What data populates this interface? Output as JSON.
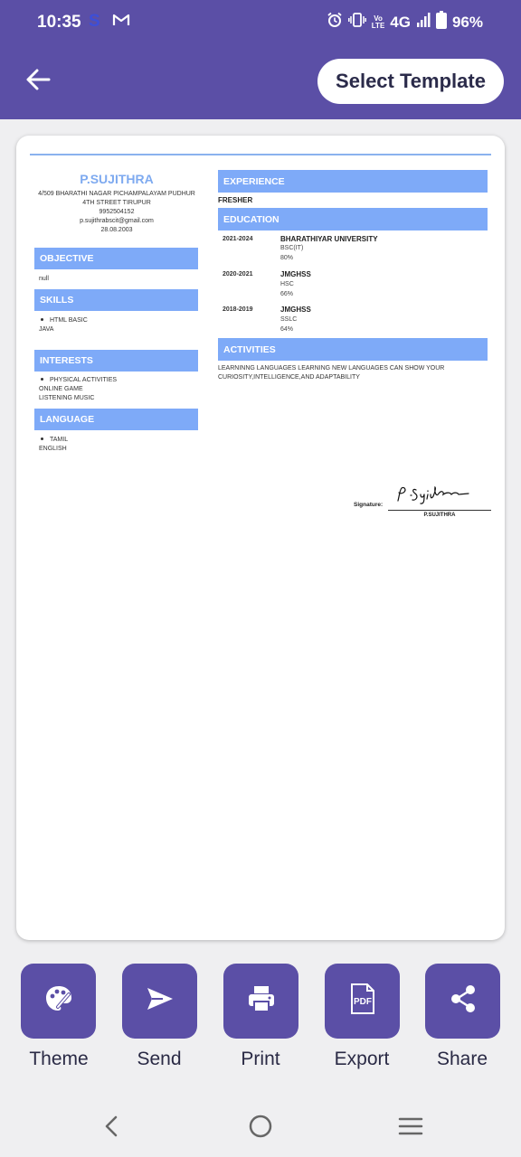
{
  "status_bar": {
    "time": "10:35",
    "s_icon": "S",
    "network": "4G",
    "volte": [
      "Vo",
      "LTE"
    ],
    "battery": "96%"
  },
  "app_bar": {
    "back_icon": "arrow-left-icon",
    "select_template_label": "Select Template"
  },
  "resume": {
    "name": "P.SUJITHRA",
    "address_lines": [
      "4/509 BHARATHI NAGAR PICHAMPALAYAM PUDHUR",
      "4TH STREET TIRUPUR",
      "9952504152",
      "p.sujithrabscit@gmail.com",
      "28.08.2003"
    ],
    "objective": {
      "title": "OBJECTIVE",
      "text": "null"
    },
    "skills": {
      "title": "SKILLS",
      "items": [
        "HTML BASIC",
        "JAVA"
      ]
    },
    "interests": {
      "title": "INTERESTS",
      "items": [
        "PHYSICAL ACTIVITIES",
        "ONLINE GAME",
        "LISTENING MUSIC"
      ]
    },
    "language": {
      "title": "LANGUAGE",
      "items": [
        "TAMIL",
        "ENGLISH"
      ]
    },
    "experience": {
      "title": "EXPERIENCE",
      "text": "FRESHER"
    },
    "education": {
      "title": "EDUCATION",
      "entries": [
        {
          "years": "2021-2024",
          "institution": "BHARATHIYAR UNIVERSITY",
          "course": "BSC(IT)",
          "score": "80%"
        },
        {
          "years": "2020-2021",
          "institution": "JMGHSS",
          "course": "HSC",
          "score": "66%"
        },
        {
          "years": "2018-2019",
          "institution": "JMGHSS",
          "course": "SSLC",
          "score": "64%"
        }
      ]
    },
    "activities": {
      "title": "ACTIVITIES",
      "text": "LEARNINNG LANGUAGES LEARNING NEW LANGUAGES CAN SHOW YOUR CURIOSITY,INTELLIGENCE,AND ADAPTABILITY"
    },
    "signature": {
      "label": "Signature:",
      "name": "P.SUJITHRA"
    }
  },
  "actions": [
    {
      "label": "Theme",
      "icon": "palette-icon"
    },
    {
      "label": "Send",
      "icon": "send-icon"
    },
    {
      "label": "Print",
      "icon": "printer-icon"
    },
    {
      "label": "Export",
      "icon": "pdf-icon"
    },
    {
      "label": "Share",
      "icon": "share-icon"
    }
  ],
  "nav_bar": {
    "icons": [
      "back-nav-icon",
      "home-nav-icon",
      "recents-nav-icon"
    ]
  },
  "colors": {
    "brand": "#5b4fa6",
    "section_header": "#7eaaf8",
    "name_accent": "#7eaaf0",
    "background": "#efeff1"
  }
}
